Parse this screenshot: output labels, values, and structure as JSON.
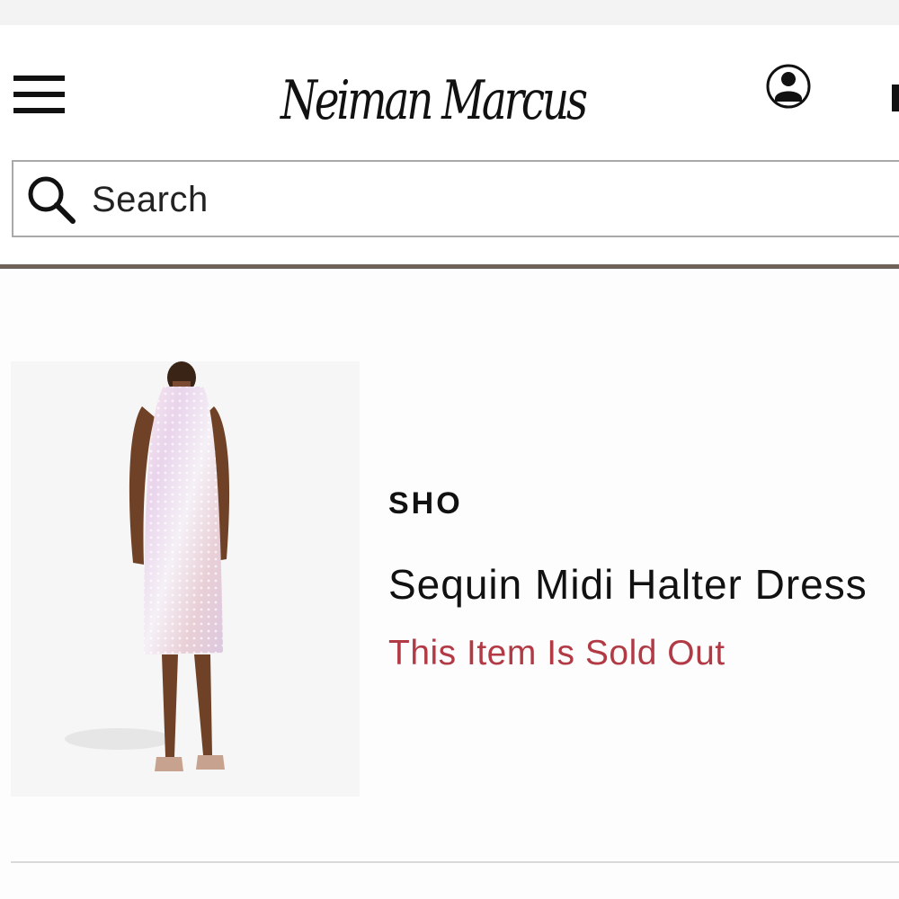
{
  "header": {
    "logo_text": "Neiman Marcus",
    "menu_icon": "hamburger-menu-icon",
    "account_icon": "account-icon",
    "bag_icon": "shopping-bag-icon"
  },
  "search": {
    "placeholder": "Search",
    "icon": "search-icon"
  },
  "product": {
    "brand": "SHO",
    "name": "Sequin Midi Halter Dress",
    "status": "This Item Is Sold Out",
    "image_alt": "Sequin Midi Halter Dress"
  },
  "colors": {
    "sold_out_text": "#b23a45",
    "divider_brown": "#6f6258"
  }
}
